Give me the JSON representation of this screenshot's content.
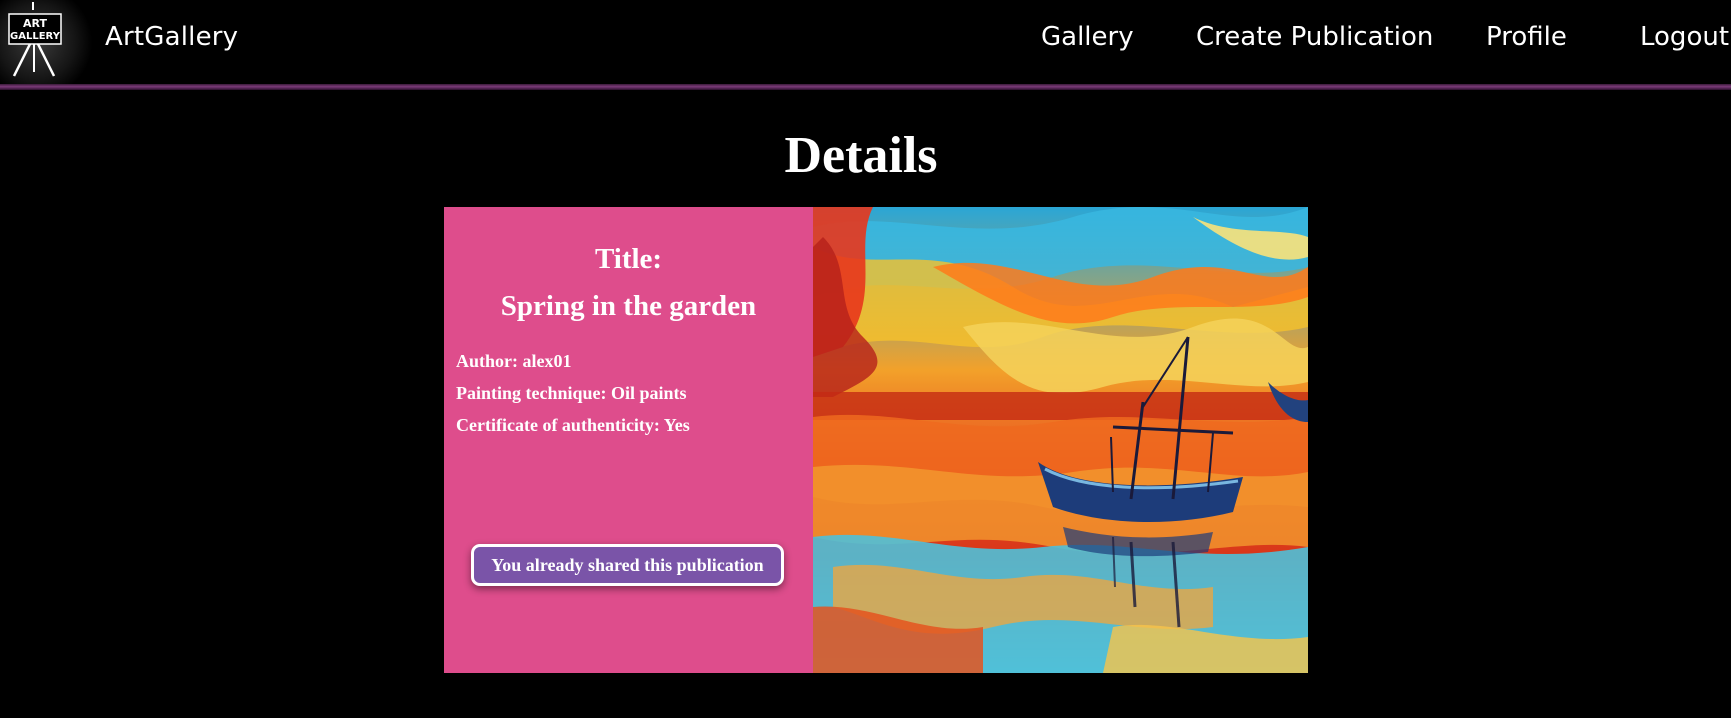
{
  "header": {
    "logo_text": "ART GALLERY",
    "brand": "ArtGallery",
    "nav": {
      "gallery": "Gallery",
      "create": "Create Publication",
      "profile": "Profile",
      "logout": "Logout"
    }
  },
  "page": {
    "title": "Details"
  },
  "publication": {
    "title_label": "Title:",
    "title": "Spring in the garden",
    "author": "Author: alex01",
    "technique": "Painting technique: Oil paints",
    "certificate": "Certificate of authenticity: Yes",
    "share_status": "You already shared this publication",
    "image_icon": "sunset-boat-painting"
  },
  "colors": {
    "info_panel": "#de4d8c",
    "share_button": "#7a54a8",
    "header_line": "#7a3a78"
  }
}
